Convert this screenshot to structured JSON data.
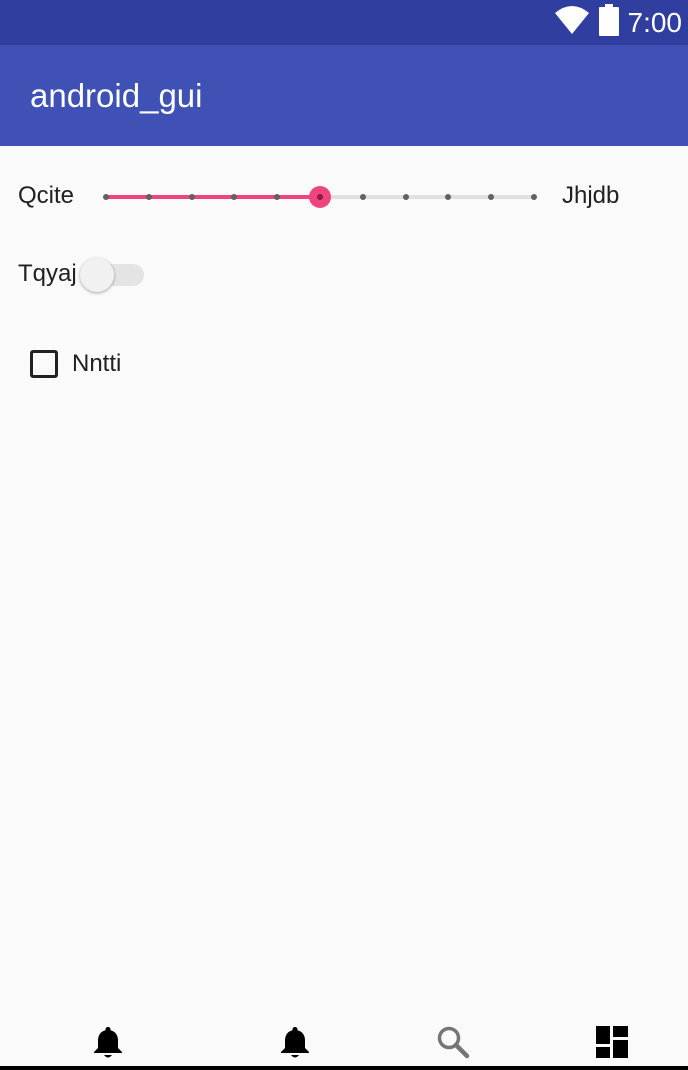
{
  "status_bar": {
    "time": "7:00",
    "icons": [
      "wifi-icon",
      "battery-icon"
    ],
    "background": "#303F9F"
  },
  "app_bar": {
    "title": "android_gui",
    "background": "#3F51B5"
  },
  "slider": {
    "min_label": "Qcite",
    "max_label": "Jhjdb",
    "steps": 10,
    "value_step": 5,
    "accent": "#F0447F"
  },
  "switch": {
    "label": "Tqyaj",
    "checked": false
  },
  "checkbox": {
    "label": "Nntti",
    "checked": false
  },
  "bottom_nav": {
    "items": [
      {
        "icon": "bell-icon",
        "color": "#000000"
      },
      {
        "icon": "bell-icon",
        "color": "#000000"
      },
      {
        "icon": "search-icon",
        "color": "#757575"
      },
      {
        "icon": "dashboard-icon",
        "color": "#000000"
      }
    ]
  }
}
